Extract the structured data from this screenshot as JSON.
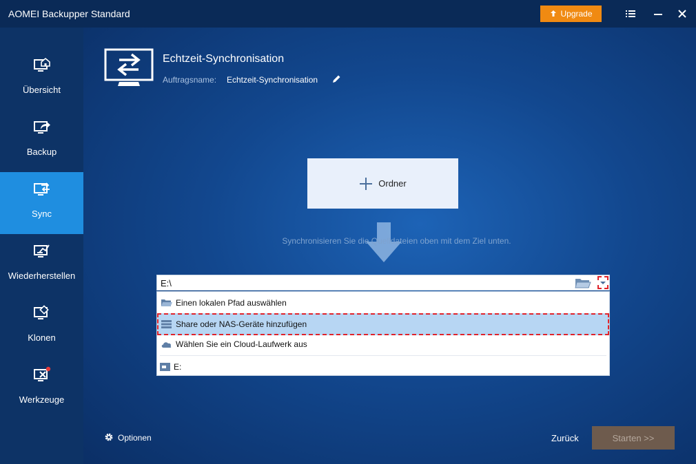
{
  "app": {
    "title": "AOMEI Backupper Standard"
  },
  "titlebar": {
    "upgrade_label": "Upgrade"
  },
  "sidebar": {
    "items": [
      {
        "label": "Übersicht",
        "icon": "monitor-home-icon"
      },
      {
        "label": "Backup",
        "icon": "monitor-share-icon"
      },
      {
        "label": "Sync",
        "icon": "monitor-sync-icon",
        "active": true
      },
      {
        "label": "Wiederherstellen",
        "icon": "monitor-restore-icon"
      },
      {
        "label": "Klonen",
        "icon": "monitor-clone-icon"
      },
      {
        "label": "Werkzeuge",
        "icon": "monitor-tools-icon"
      }
    ]
  },
  "header": {
    "title": "Echtzeit-Synchronisation",
    "task_name_label": "Auftragsname:",
    "task_name_value": "Echtzeit-Synchronisation"
  },
  "source": {
    "add_folder_label": "Ordner"
  },
  "hint": "Synchronisieren Sie die Quelldateien oben mit dem Ziel unten.",
  "destination": {
    "path": "E:\\",
    "dropdown_items": [
      {
        "label": "Einen lokalen Pfad auswählen",
        "icon": "folder-open-icon"
      },
      {
        "label": "Share oder NAS-Geräte hinzufügen",
        "icon": "nas-icon",
        "selected": true
      },
      {
        "label": "Wählen Sie ein Cloud-Laufwerk aus",
        "icon": "cloud-icon"
      },
      {
        "label": "E:",
        "icon": "drive-icon"
      }
    ]
  },
  "footer": {
    "options_label": "Optionen",
    "back_label": "Zurück",
    "start_label": "Starten >>"
  },
  "colors": {
    "accent": "#1f8ee0",
    "upgrade": "#f08a12",
    "highlight_border": "#e0222a",
    "selected_row": "#b7d6f3",
    "start_disabled": "#6e5b4d"
  }
}
